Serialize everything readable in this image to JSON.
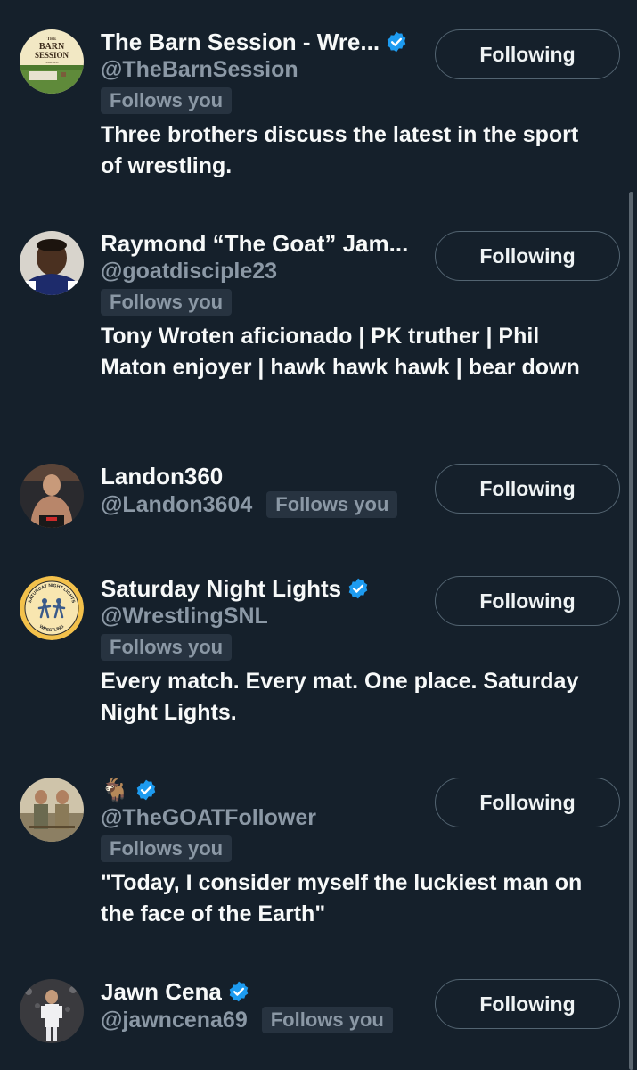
{
  "colors": {
    "background": "#15202b",
    "text_primary": "#f7f9f9",
    "text_secondary": "#8b98a5",
    "verified_blue": "#1d9bf0",
    "badge_bg": "#273340",
    "button_border": "#536471"
  },
  "users": [
    {
      "name": "The Barn Session - Wre...",
      "verified": true,
      "handle": "@TheBarnSession",
      "follows_you": "Follows you",
      "bio": "Three brothers discuss the latest in the sport of wrestling.",
      "button": "Following",
      "avatar_text": {
        "line1": "THE",
        "line2": "BARN",
        "line3": "SESSION",
        "line4": "PODCAST"
      }
    },
    {
      "name": "Raymond “The Goat” Jam...",
      "verified": false,
      "handle": "@goatdisciple23",
      "follows_you": "Follows you",
      "bio": "Tony Wroten aficionado | PK truther | Phil Maton enjoyer | hawk hawk hawk | bear down",
      "button": "Following"
    },
    {
      "name": "Landon360",
      "verified": false,
      "handle": "@Landon3604",
      "follows_you": "Follows you",
      "bio": "",
      "button": "Following"
    },
    {
      "name": "Saturday Night Lights",
      "verified": true,
      "handle": "@WrestlingSNL",
      "follows_you": "Follows you",
      "bio": "Every match. Every mat. One place. Saturday Night Lights.",
      "button": "Following",
      "avatar_text": {
        "top": "SATURDAY NIGHT LIGHTS",
        "bottom": "WRESTLING"
      }
    },
    {
      "name": "🐐",
      "verified": true,
      "handle": "@TheGOATFollower",
      "follows_you": "Follows you",
      "bio": "\"Today, I consider myself the luckiest man on the face of the Earth\"",
      "button": "Following"
    },
    {
      "name": "Jawn Cena",
      "verified": true,
      "handle": "@jawncena69",
      "follows_you": "Follows you",
      "bio": "",
      "button": "Following"
    }
  ]
}
